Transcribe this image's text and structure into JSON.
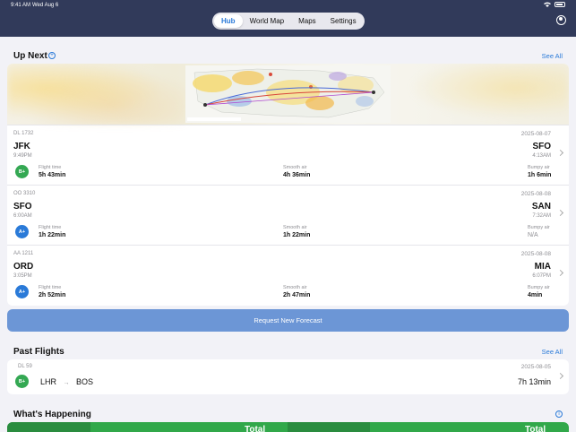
{
  "status": {
    "time": "9:41 AM",
    "date": "Wed Aug 6"
  },
  "nav": {
    "tabs": [
      {
        "label": "Hub",
        "active": true
      },
      {
        "label": "World Map",
        "active": false
      },
      {
        "label": "Maps",
        "active": false
      },
      {
        "label": "Settings",
        "active": false
      }
    ]
  },
  "up_next": {
    "title": "Up Next",
    "see_all": "See All",
    "flights": [
      {
        "flight_no": "DL 1732",
        "date": "2025-08-07",
        "origin": "JFK",
        "origin_time": "9:49PM",
        "dest": "SFO",
        "dest_time": "4:13AM",
        "grade": "B+",
        "grade_color": "#34a853",
        "flight_time_label": "Flight time",
        "flight_time": "5h 43min",
        "smooth_label": "Smooth air",
        "smooth": "4h 36min",
        "bumpy_label": "Bumpy air",
        "bumpy": "1h 6min"
      },
      {
        "flight_no": "OO 3310",
        "date": "2025-08-08",
        "origin": "SFO",
        "origin_time": "6:00AM",
        "dest": "SAN",
        "dest_time": "7:32AM",
        "grade": "A+",
        "grade_color": "#2a7ad8",
        "flight_time_label": "Flight time",
        "flight_time": "1h 22min",
        "smooth_label": "Smooth air",
        "smooth": "1h 22min",
        "bumpy_label": "Bumpy air",
        "bumpy": "N/A"
      },
      {
        "flight_no": "AA 1211",
        "date": "2025-08-08",
        "origin": "ORD",
        "origin_time": "3:05PM",
        "dest": "MIA",
        "dest_time": "6:07PM",
        "grade": "A+",
        "grade_color": "#2a7ad8",
        "flight_time_label": "Flight time",
        "flight_time": "2h 52min",
        "smooth_label": "Smooth air",
        "smooth": "2h 47min",
        "bumpy_label": "Bumpy air",
        "bumpy": "4min"
      }
    ]
  },
  "request_button": "Request New Forecast",
  "past_flights": {
    "title": "Past Flights",
    "see_all": "See All",
    "flight": {
      "flight_no": "DL 59",
      "date": "2025-08-05",
      "origin": "LHR",
      "dest": "BOS",
      "duration": "7h 13min",
      "grade": "B+",
      "grade_color": "#34a853"
    }
  },
  "whats_happening": {
    "title": "What's Happening",
    "tile_text_1": "Total",
    "tile_text_2": "Total"
  },
  "colors": {
    "accent": "#2a7ad8",
    "header": "#313a5a",
    "green": "#34a853",
    "button": "#6c96d6"
  }
}
